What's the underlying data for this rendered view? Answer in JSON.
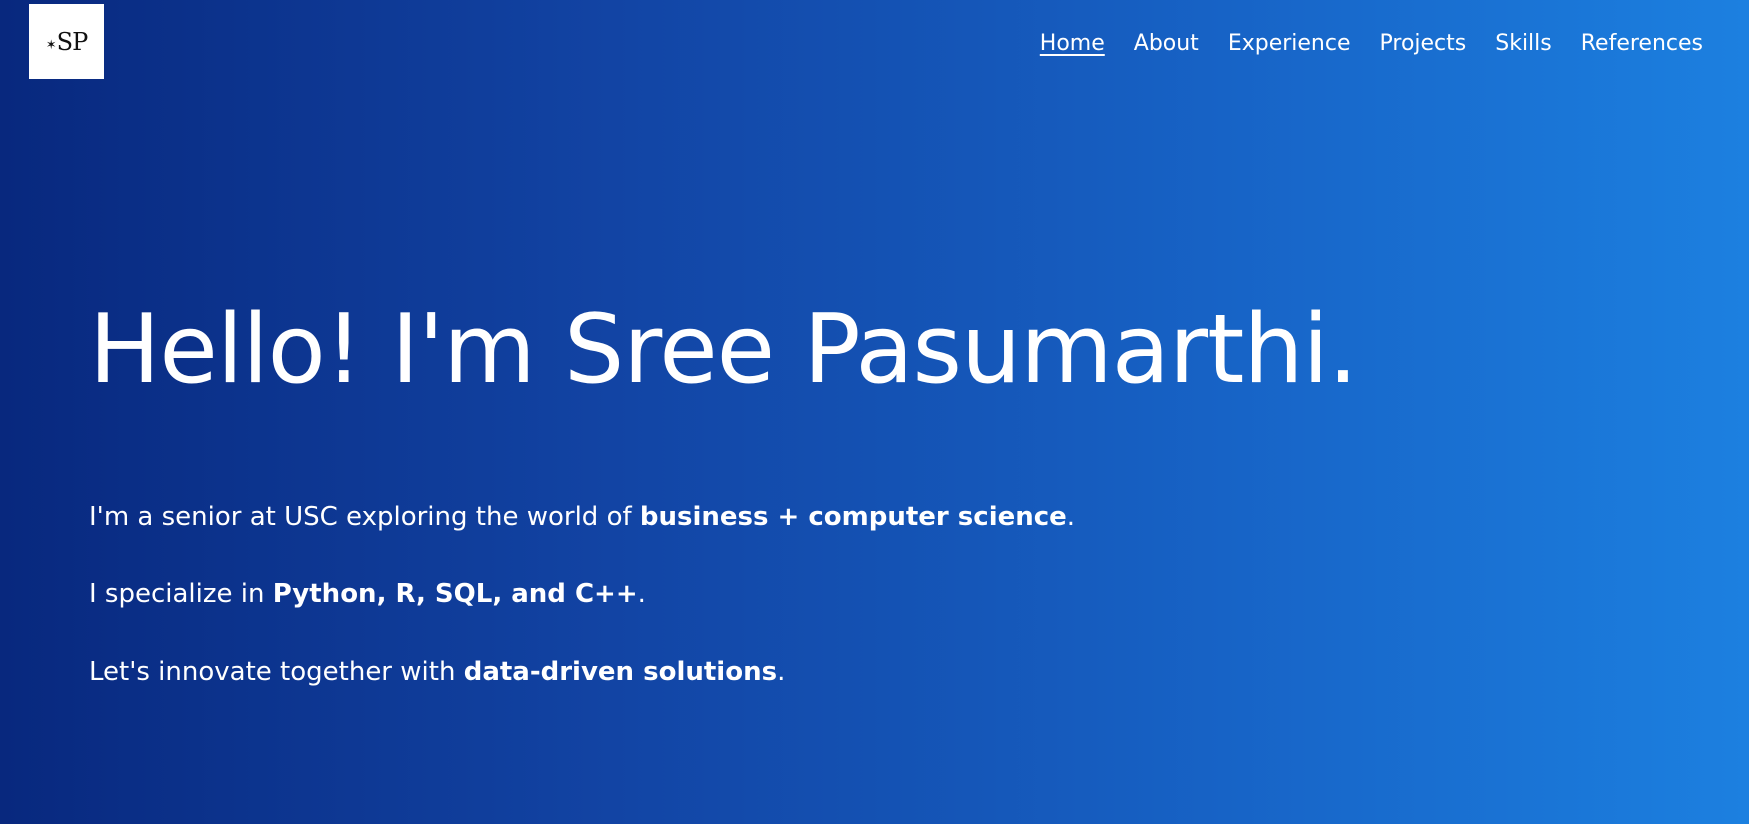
{
  "logo": {
    "text": "SP",
    "star": "✶"
  },
  "nav": {
    "items": [
      "Home",
      "About",
      "Experience",
      "Projects",
      "Skills",
      "References"
    ],
    "active": "Home"
  },
  "hero": {
    "heading": "Hello! I'm Sree Pasumarthi."
  },
  "intro": {
    "line1": {
      "pre": "I'm a senior at USC exploring the world of ",
      "bold": "business + computer science",
      "post": "."
    },
    "line2": {
      "pre": "I specialize in ",
      "bold": "Python, R, SQL, and C++",
      "post": "."
    },
    "line3": {
      "pre": "Let's innovate together with ",
      "bold": "data-driven solutions",
      "post": "."
    }
  },
  "colors": {
    "gradient_start": "#08287e",
    "gradient_end": "#1c80e0",
    "text": "#ffffff"
  }
}
